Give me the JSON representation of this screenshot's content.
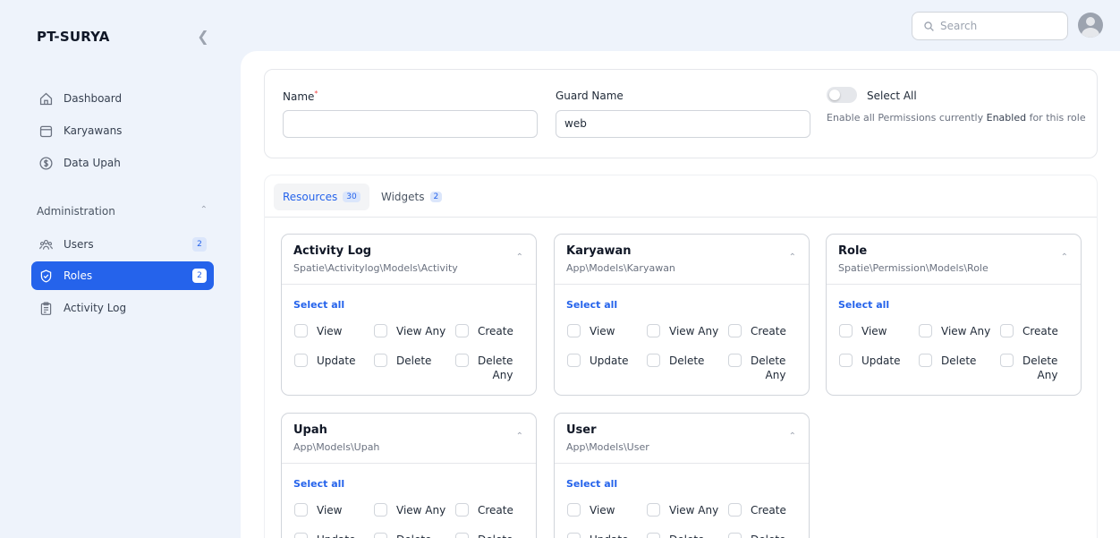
{
  "brand": "PT-SURYA",
  "nav": {
    "main_items": [
      {
        "label": "Dashboard",
        "icon": "home-icon"
      },
      {
        "label": "Karyawans",
        "icon": "folder-icon"
      },
      {
        "label": "Data Upah",
        "icon": "dollar-icon"
      }
    ],
    "group": {
      "label": "Administration"
    },
    "admin_items": [
      {
        "label": "Users",
        "icon": "users-icon",
        "badge": "2"
      },
      {
        "label": "Roles",
        "icon": "shield-check-icon",
        "badge": "2",
        "active": true
      },
      {
        "label": "Activity Log",
        "icon": "clipboard-icon"
      }
    ]
  },
  "topbar": {
    "search_placeholder": "Search"
  },
  "form": {
    "name_label": "Name",
    "name_required_mark": "*",
    "name_value": "",
    "guard_label": "Guard Name",
    "guard_value": "web",
    "select_all_label": "Select All",
    "select_all_on": false,
    "help_pre": "Enable all Permissions currently ",
    "help_bold": "Enabled",
    "help_post": " for this role"
  },
  "tabs": [
    {
      "label": "Resources",
      "count": "30",
      "active": true
    },
    {
      "label": "Widgets",
      "count": "2",
      "active": false
    }
  ],
  "select_all_text": "Select all",
  "resources": [
    {
      "title": "Activity Log",
      "model": "Spatie\\Activitylog\\Models\\Activity",
      "perms": [
        "View",
        "View Any",
        "Create",
        "Update",
        "Delete",
        "Delete Any"
      ]
    },
    {
      "title": "Karyawan",
      "model": "App\\Models\\Karyawan",
      "perms": [
        "View",
        "View Any",
        "Create",
        "Update",
        "Delete",
        "Delete Any"
      ]
    },
    {
      "title": "Role",
      "model": "Spatie\\Permission\\Models\\Role",
      "perms": [
        "View",
        "View Any",
        "Create",
        "Update",
        "Delete",
        "Delete Any"
      ]
    },
    {
      "title": "Upah",
      "model": "App\\Models\\Upah",
      "perms": [
        "View",
        "View Any",
        "Create",
        "Update",
        "Delete",
        "Delete"
      ]
    },
    {
      "title": "User",
      "model": "App\\Models\\User",
      "perms": [
        "View",
        "View Any",
        "Create",
        "Update",
        "Delete",
        "Delete"
      ]
    }
  ],
  "colors": {
    "accent": "#2563eb",
    "sidebar_bg": "#eef3fb",
    "badge_bg": "#dbe6fb"
  }
}
